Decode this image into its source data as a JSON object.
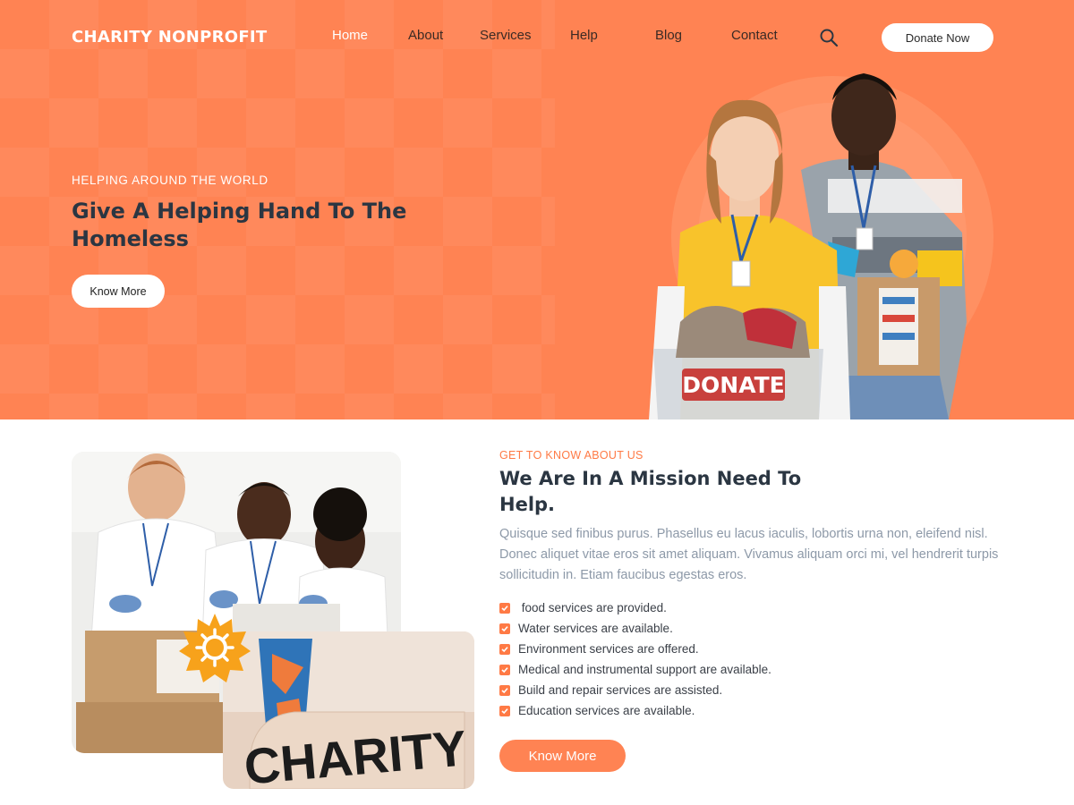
{
  "brand": {
    "logo_text": "CHARITY NONPROFIT"
  },
  "nav": {
    "items": [
      {
        "label": "Home"
      },
      {
        "label": "About"
      },
      {
        "label": "Services"
      },
      {
        "label": "Help"
      },
      {
        "label": "Blog"
      },
      {
        "label": "Contact"
      }
    ],
    "search_icon": "search-icon",
    "donate_label": "Donate Now"
  },
  "hero": {
    "subtitle": "HELPING AROUND THE WORLD",
    "title": "Give A Helping Hand To The Homeless",
    "button_label": "Know More",
    "box_text": "DONATE"
  },
  "about": {
    "subtitle": "GET TO KNOW ABOUT US",
    "title": "We Are In A Mission Need To Help.",
    "body": "Quisque sed finibus purus. Phasellus eu lacus iaculis, lobortis urna non, eleifend nisl. Donec aliquet vitae eros sit amet aliquam. Vivamus aliquam orci mi, vel hendrerit turpis sollicitudin in. Etiam faucibus egestas eros.",
    "list": [
      " food services are provided.",
      "Water services are available.",
      "Environment services are offered.",
      "Medical and instrumental support are available.",
      "Build and repair services are assisted.",
      "Education services are available."
    ],
    "button_label": "Know More",
    "sign_text": "CHARITY"
  },
  "colors": {
    "accent": "#ff8353",
    "heading": "#2b3642",
    "body_text": "#8d99a8"
  }
}
